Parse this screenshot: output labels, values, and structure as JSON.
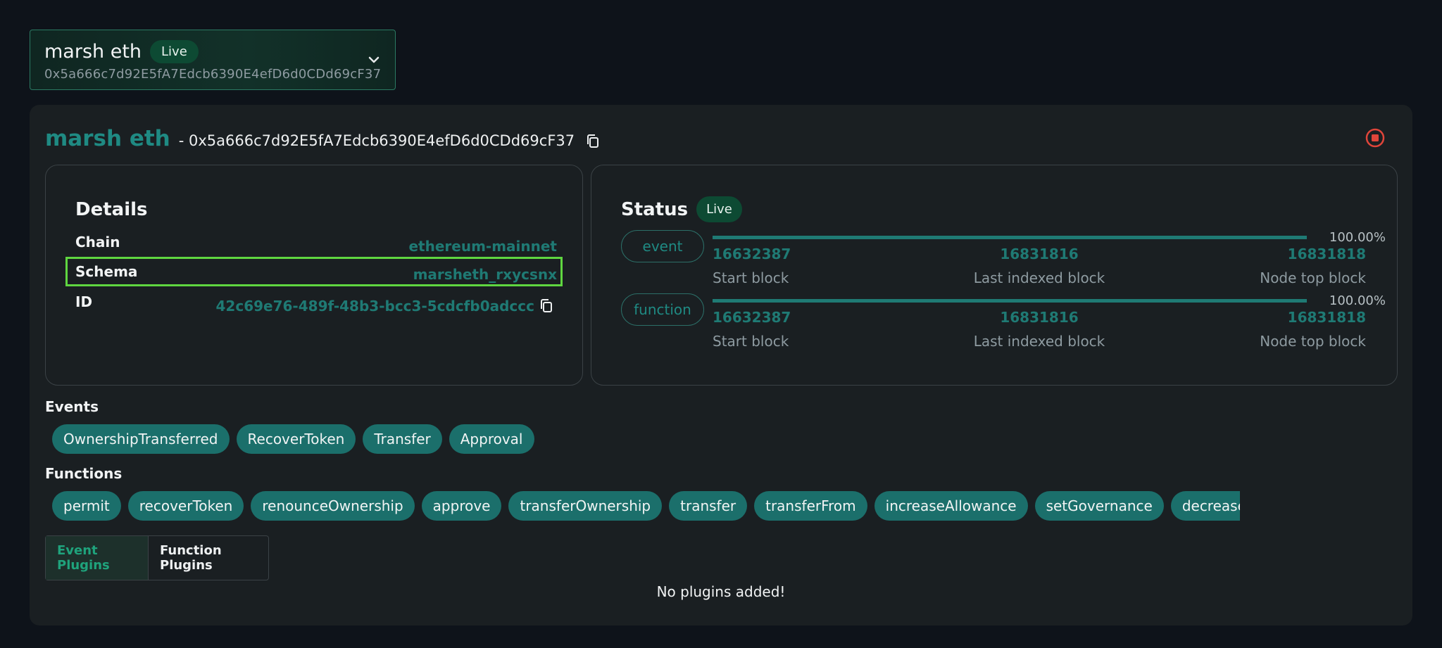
{
  "selector": {
    "name": "marsh eth",
    "status": "Live",
    "address": "0x5a666c7d92E5fA7Edcb6390E4efD6d0CDd69cF37"
  },
  "header": {
    "title": "marsh eth",
    "address": "- 0x5a666c7d92E5fA7Edcb6390E4efD6d0CDd69cF37"
  },
  "details": {
    "title": "Details",
    "rows": [
      {
        "label": "Chain",
        "value": "ethereum-mainnet"
      },
      {
        "label": "Schema",
        "value": "marsheth_rxycsnx"
      },
      {
        "label": "ID",
        "value": "42c69e76-489f-48b3-bcc3-5cdcfb0adccc"
      }
    ]
  },
  "status": {
    "title": "Status",
    "badge": "Live",
    "groups": [
      {
        "name": "event",
        "progress": "100.00%",
        "start": "16632387",
        "start_label": "Start block",
        "last": "16831816",
        "last_label": "Last indexed block",
        "top": "16831818",
        "top_label": "Node top block"
      },
      {
        "name": "function",
        "progress": "100.00%",
        "start": "16632387",
        "start_label": "Start block",
        "last": "16831816",
        "last_label": "Last indexed block",
        "top": "16831818",
        "top_label": "Node top block"
      }
    ]
  },
  "events": {
    "label": "Events",
    "items": [
      "OwnershipTransferred",
      "RecoverToken",
      "Transfer",
      "Approval"
    ]
  },
  "functions": {
    "label": "Functions",
    "items": [
      "permit",
      "recoverToken",
      "renounceOwnership",
      "approve",
      "transferOwnership",
      "transfer",
      "transferFrom",
      "increaseAllowance",
      "setGovernance",
      "decreaseA"
    ]
  },
  "plugins": {
    "tabs": [
      "Event Plugins",
      "Function Plugins"
    ],
    "empty": "No plugins added!"
  },
  "colors": {
    "accent": "#1f8a83",
    "highlight": "#5fd640",
    "live_badge": "#0d4a33",
    "stop": "#e0453a"
  },
  "icons": [
    "chevron-down-icon",
    "copy-icon",
    "stop-icon"
  ]
}
